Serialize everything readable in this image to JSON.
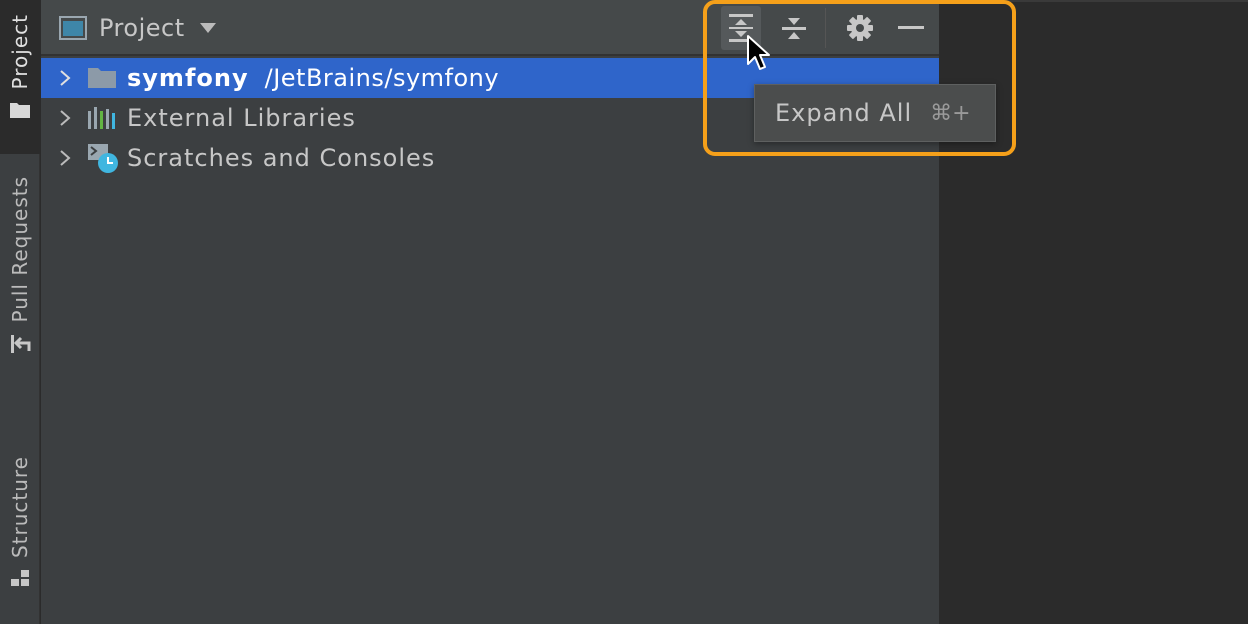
{
  "stripe": {
    "project_label": "Project",
    "pull_requests_label": "Pull Requests",
    "structure_label": "Structure"
  },
  "panel": {
    "view_title": "Project",
    "tree": [
      {
        "name": "symfony",
        "path": "/JetBrains/symfony",
        "icon": "folder-icon",
        "selected": true
      },
      {
        "name": "External Libraries",
        "icon": "libraries-icon",
        "selected": false
      },
      {
        "name": "Scratches and Consoles",
        "icon": "scratches-icon",
        "selected": false
      }
    ]
  },
  "toolbar": {
    "buttons": [
      "expand-all-icon",
      "collapse-all-icon",
      "gear-icon",
      "minimize-icon"
    ]
  },
  "tooltip": {
    "label": "Expand All",
    "shortcut": "⌘+"
  },
  "colors": {
    "selection": "#2f65ca",
    "highlight": "#f5a01a",
    "panel_bg": "#3c3f41",
    "header_bg": "#45494a"
  }
}
